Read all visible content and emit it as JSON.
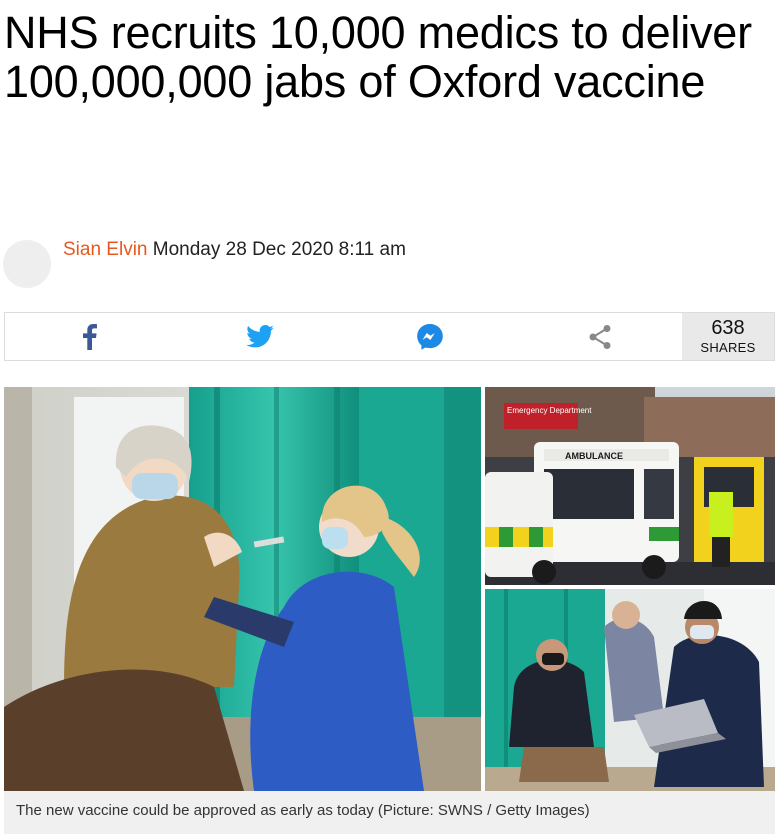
{
  "article": {
    "headline": "NHS recruits 10,000 medics to deliver 100,000,000 jabs of Oxford vaccine",
    "author": "Sian Elvin",
    "date": "Monday 28 Dec 2020 8:11 am"
  },
  "share": {
    "icons": [
      "facebook-icon",
      "twitter-icon",
      "messenger-icon",
      "share-icon"
    ],
    "count": "638",
    "count_label": "SHARES",
    "colors": {
      "facebook": "#3b5998",
      "twitter": "#1da1f2",
      "messenger": "#1e88e5",
      "generic": "#888888"
    }
  },
  "hero": {
    "signs": {
      "emergency": "Emergency Department",
      "ambulance": "AMBULANCE"
    },
    "caption": "The new vaccine could be approved as early as today (Picture: SWNS / Getty Images)"
  }
}
